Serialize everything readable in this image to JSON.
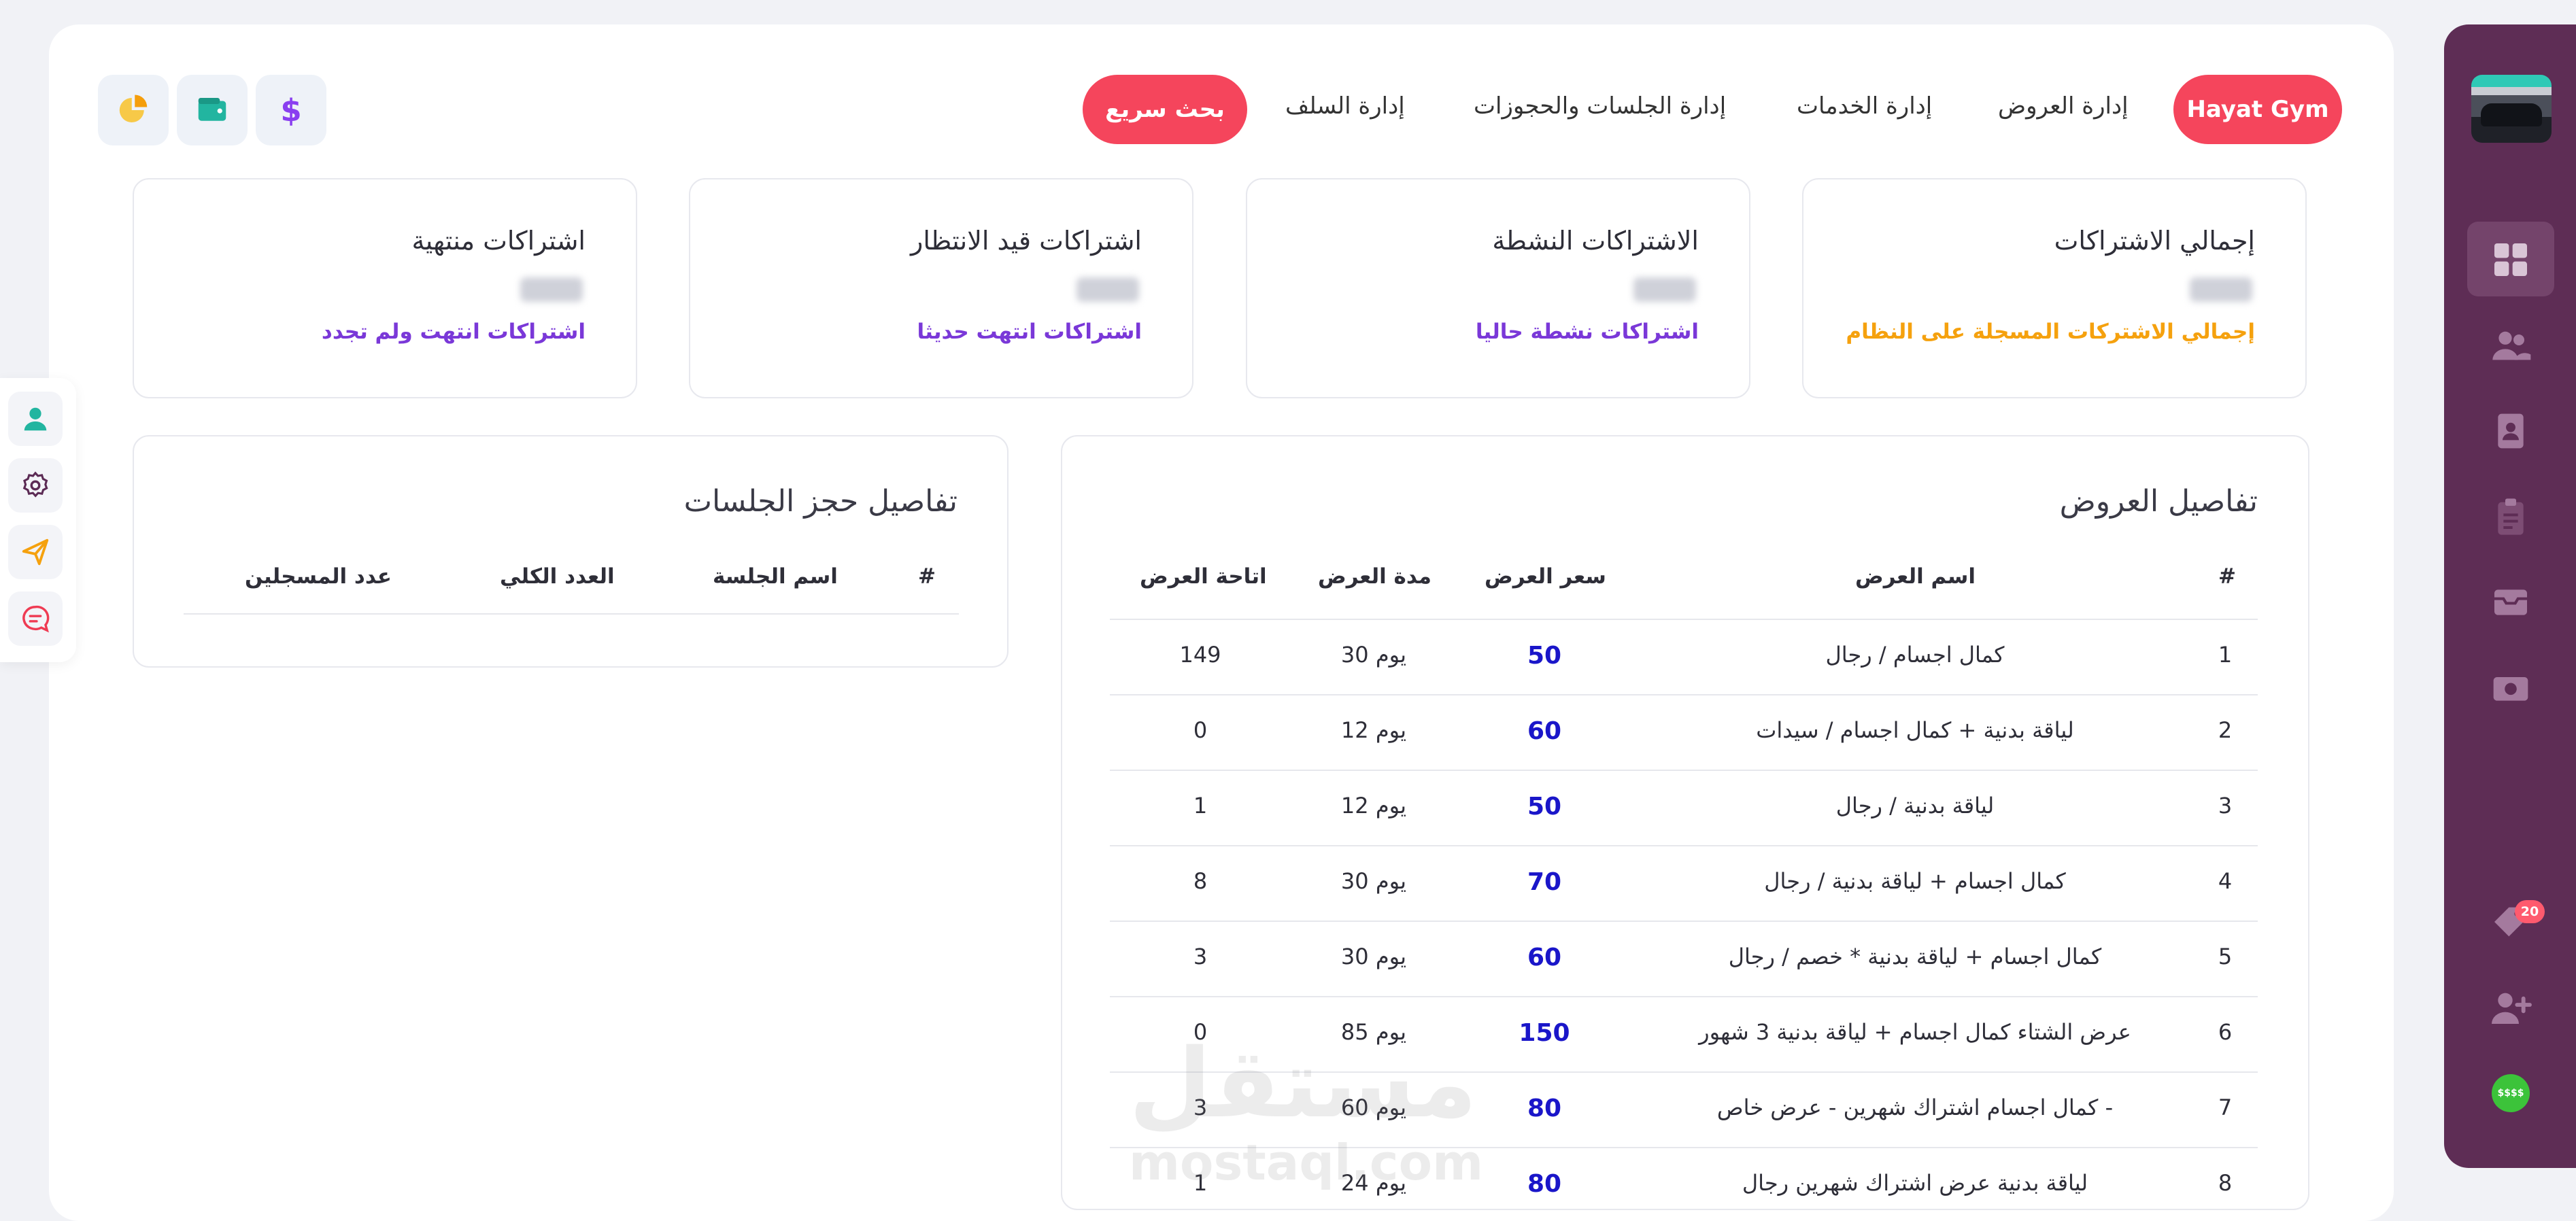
{
  "nav": {
    "brand": "Hayat Gym",
    "links": [
      "إدارة العروض",
      "إدارة الخدمات",
      "إدارة الجلسات والحجوزات",
      "إدارة السلف"
    ],
    "search_button": "بحث سريع",
    "tools": [
      "dollar-icon",
      "wallet-icon",
      "chart-pie-icon"
    ]
  },
  "stats": [
    {
      "title": "إجمالي الاشتراكات",
      "subtitle": "إجمالي الاشتركات المسجلة على النظام",
      "color": "#f5a10e"
    },
    {
      "title": "الاشتراكات النشطة",
      "subtitle": "اشتراكات نشطة حاليا",
      "color": "#7a38d8"
    },
    {
      "title": "اشتراكات قيد الانتظار",
      "subtitle": "اشتراكات انتهت حديثا",
      "color": "#7a38d8"
    },
    {
      "title": "اشتراكات منتهية",
      "subtitle": "اشتراكات انتهت ولم تجدد",
      "color": "#7a38d8"
    }
  ],
  "offers": {
    "title": "تفاصيل العروض",
    "columns": [
      "#",
      "اسم العرض",
      "سعر العرض",
      "مدة العرض",
      "اتاحة العرض"
    ],
    "rows": [
      {
        "n": "1",
        "name": "كمال اجسام / رجال",
        "price": "50",
        "duration": "30 يوم",
        "availability": "149"
      },
      {
        "n": "2",
        "name": "لياقة بدنية + كمال اجسام / سيدات",
        "price": "60",
        "duration": "12 يوم",
        "availability": "0"
      },
      {
        "n": "3",
        "name": "لياقة بدنية / رجال",
        "price": "50",
        "duration": "12 يوم",
        "availability": "1"
      },
      {
        "n": "4",
        "name": "كمال اجسام + لياقة بدنية / رجال",
        "price": "70",
        "duration": "30 يوم",
        "availability": "8"
      },
      {
        "n": "5",
        "name": "كمال اجسام + لياقة بدنية * خصم / رجال",
        "price": "60",
        "duration": "30 يوم",
        "availability": "3"
      },
      {
        "n": "6",
        "name": "عرض الشتاء كمال اجسام + لياقة بدنية 3 شهور",
        "price": "150",
        "duration": "85 يوم",
        "availability": "0"
      },
      {
        "n": "7",
        "name": "كمال اجسام اشتراك شهرين - عرض خاص -",
        "price": "80",
        "duration": "60 يوم",
        "availability": "3"
      },
      {
        "n": "8",
        "name": "لياقة بدنية عرض اشتراك شهرين رجال",
        "price": "80",
        "duration": "24 يوم",
        "availability": "1"
      }
    ]
  },
  "sessions": {
    "title": "تفاصيل حجز الجلسات",
    "columns": [
      "#",
      "اسم الجلسة",
      "العدد الكلي",
      "عدد المسجلين"
    ]
  },
  "sidebar": {
    "items": [
      "dashboard-icon",
      "users-icon",
      "contact-card-icon",
      "clipboard-icon",
      "inbox-icon",
      "cash-icon"
    ],
    "notifications_badge": "20",
    "coin_label": "$$$$"
  },
  "float_bar": [
    "user-icon",
    "settings-icon",
    "send-icon",
    "chat-icon"
  ],
  "watermark": {
    "arabic": "مستقل",
    "latin": "mostaql.com"
  }
}
